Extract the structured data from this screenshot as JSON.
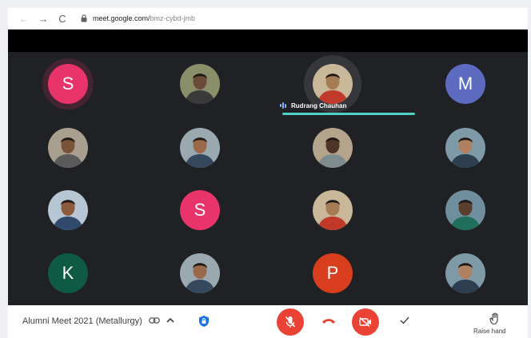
{
  "browser": {
    "url_host": "meet.google.com/",
    "url_path": "bmz-cybd-jmb",
    "nav": {
      "back": "←",
      "forward": "→",
      "reload": "C"
    }
  },
  "participants": [
    {
      "kind": "letter",
      "initial": "S",
      "color": "#e8336b"
    },
    {
      "kind": "photo",
      "avatar": "person-photo-avatar"
    },
    {
      "kind": "photo",
      "avatar": "person-photo-avatar",
      "name": "Rudrang Chauhan",
      "speaking": true
    },
    {
      "kind": "letter",
      "initial": "M",
      "color": "#5c6bc0"
    },
    {
      "kind": "photo",
      "avatar": "person-photo-avatar"
    },
    {
      "kind": "photo",
      "avatar": "person-photo-avatar"
    },
    {
      "kind": "photo",
      "avatar": "person-photo-avatar"
    },
    {
      "kind": "photo",
      "avatar": "person-photo-avatar"
    },
    {
      "kind": "photo",
      "avatar": "person-photo-avatar"
    },
    {
      "kind": "letter",
      "initial": "S",
      "color": "#e8336b"
    },
    {
      "kind": "photo",
      "avatar": "person-photo-avatar"
    },
    {
      "kind": "photo",
      "avatar": "person-photo-avatar"
    },
    {
      "kind": "letter",
      "initial": "K",
      "color": "#0f5a43"
    },
    {
      "kind": "photo",
      "avatar": "person-photo-avatar"
    },
    {
      "kind": "letter",
      "initial": "P",
      "color": "#d93f1f"
    },
    {
      "kind": "photo",
      "avatar": "person-photo-avatar"
    }
  ],
  "bottom_bar": {
    "meeting_title": "Alumni Meet 2021 (Metallurgy)",
    "raise_hand_label": "Raise hand",
    "colors": {
      "danger": "#ea4335",
      "shield": "#1a73e8"
    }
  }
}
